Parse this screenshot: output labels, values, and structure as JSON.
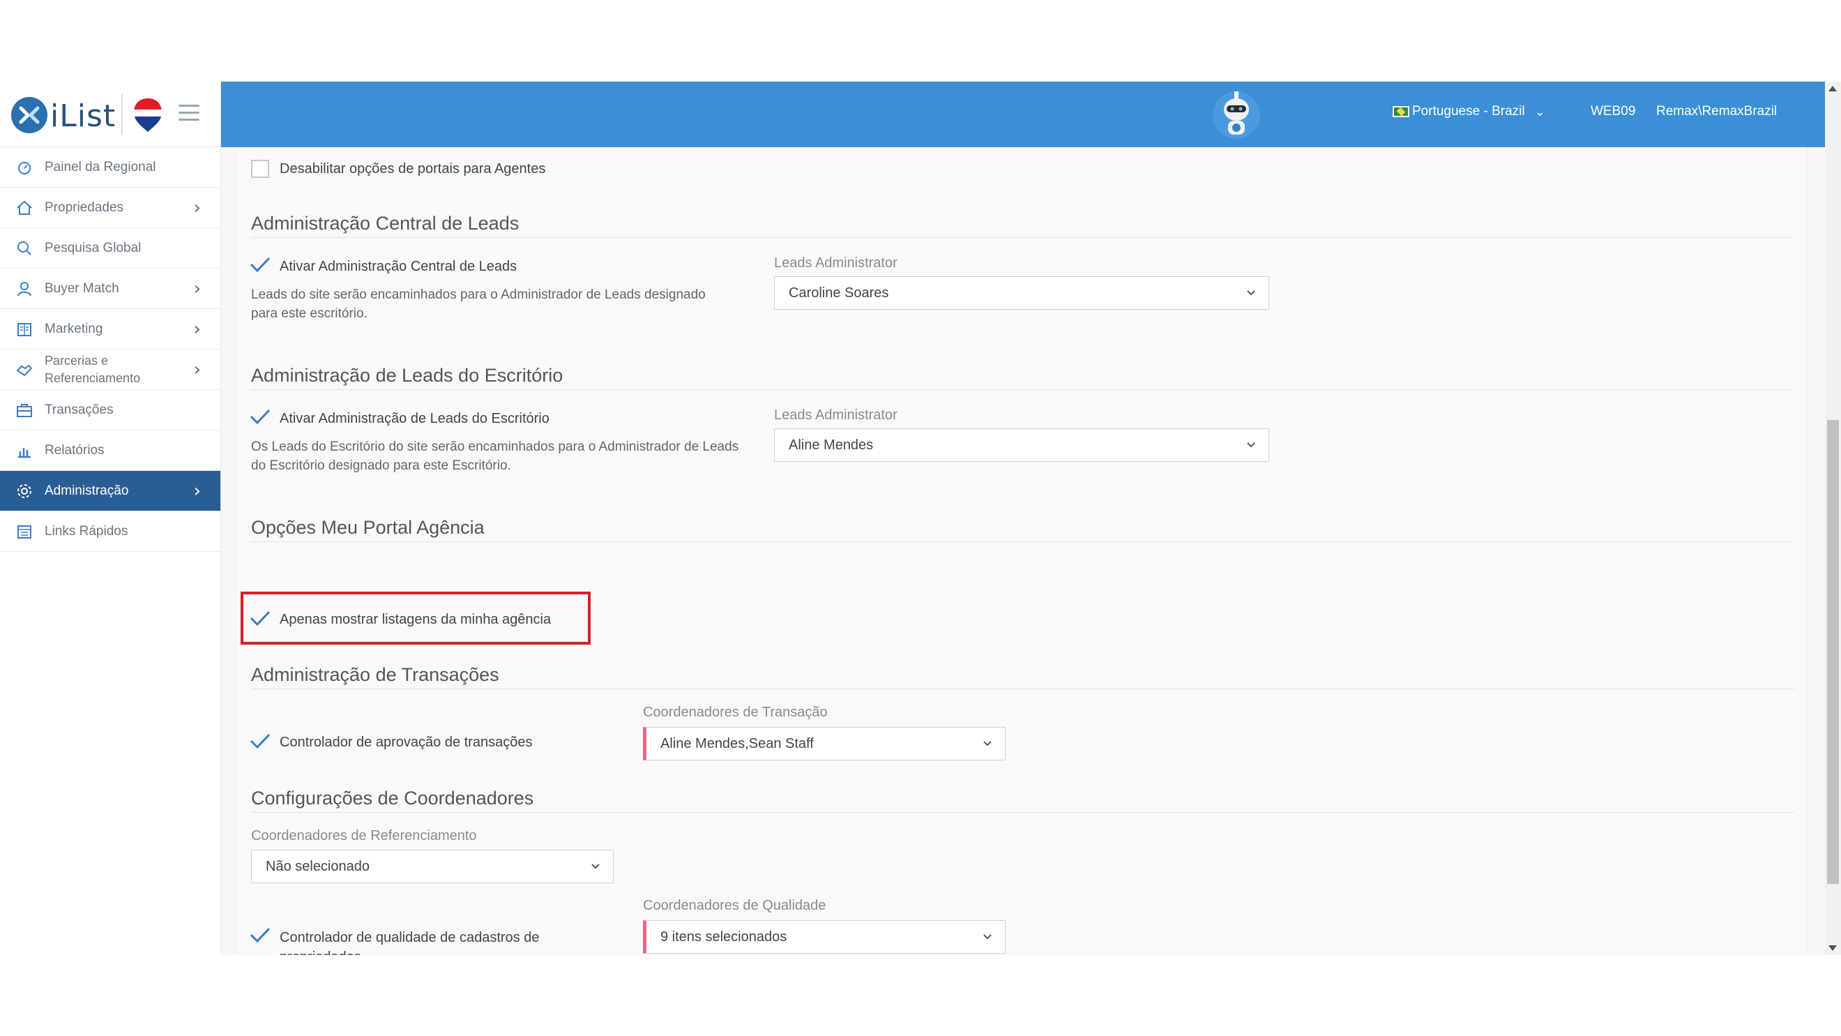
{
  "brand": {
    "name": "iList"
  },
  "sidebar": {
    "items": [
      {
        "label": "Painel da Regional",
        "icon": "dashboard-icon",
        "chevron": false
      },
      {
        "label": "Propriedades",
        "icon": "home-icon",
        "chevron": true
      },
      {
        "label": "Pesquisa Global",
        "icon": "search-icon",
        "chevron": false
      },
      {
        "label": "Buyer Match",
        "icon": "user-icon",
        "chevron": true
      },
      {
        "label": "Marketing",
        "icon": "book-icon",
        "chevron": true
      },
      {
        "label": "Parcerias e Referenciamento",
        "icon": "handshake-icon",
        "chevron": true
      },
      {
        "label": "Transações",
        "icon": "briefcase-icon",
        "chevron": false
      },
      {
        "label": "Relatórios",
        "icon": "bar-chart-icon",
        "chevron": false
      },
      {
        "label": "Administração",
        "icon": "gear-icon",
        "chevron": true,
        "active": true
      },
      {
        "label": "Links Rápidos",
        "icon": "link-list-icon",
        "chevron": false
      }
    ]
  },
  "topbar": {
    "language": "Portuguese - Brazil",
    "server": "WEB09",
    "user": "Remax\\RemaxBrazil",
    "accent": "#3a8fd6"
  },
  "content": {
    "disable_portals_label": "Desabilitar opções de portais para Agentes",
    "central_leads": {
      "title": "Administração Central de Leads",
      "checkbox_label": "Ativar Administração Central de Leads",
      "description": "Leads do site serão encaminhados para o Administrador de Leads designado para este escritório.",
      "field_label": "Leads Administrator",
      "selected": "Caroline Soares"
    },
    "office_leads": {
      "title": "Administração de Leads do Escritório",
      "checkbox_label": "Ativar Administração de Leads do Escritório",
      "description": "Os Leads do Escritório do site serão encaminhados para o Administrador de Leads do Escritório designado para este Escritório.",
      "field_label": "Leads Administrator",
      "selected": "Aline Mendes"
    },
    "portal_options": {
      "title": "Opções Meu Portal Agência",
      "checkbox_label": "Apenas mostrar listagens da minha agência"
    },
    "transactions": {
      "title": "Administração de Transações",
      "checkbox_label": "Controlador de aprovação de transações",
      "field_label": "Coordenadores de Transação",
      "selected": "Aline Mendes,Sean Staff"
    },
    "coordinators": {
      "title": "Configurações de Coordenadores",
      "referral_label": "Coordenadores de Referenciamento",
      "referral_selected": "Não selecionado",
      "quality_checkbox_label": "Controlador de qualidade de cadastros de propriedades",
      "quality_field_label": "Coordenadores de Qualidade",
      "quality_selected": "9 itens selecionados"
    }
  }
}
